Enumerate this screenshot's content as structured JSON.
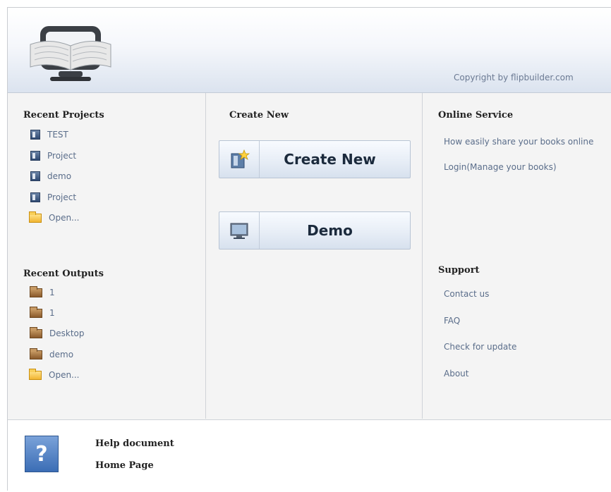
{
  "header": {
    "copyright": "Copyright by flipbuilder.com",
    "logo_icon": "monitor-book-logo-icon"
  },
  "recent_projects": {
    "title": "Recent Projects",
    "items": [
      {
        "label": "TEST",
        "icon": "document-icon"
      },
      {
        "label": "Project",
        "icon": "document-icon"
      },
      {
        "label": "demo",
        "icon": "document-icon"
      },
      {
        "label": "Project",
        "icon": "document-icon"
      },
      {
        "label": "Open...",
        "icon": "folder-open-icon"
      }
    ]
  },
  "recent_outputs": {
    "title": "Recent Outputs",
    "items": [
      {
        "label": "1",
        "icon": "box-icon"
      },
      {
        "label": "1",
        "icon": "box-icon"
      },
      {
        "label": "Desktop",
        "icon": "box-icon"
      },
      {
        "label": "demo",
        "icon": "box-icon"
      },
      {
        "label": "Open...",
        "icon": "folder-open-icon"
      }
    ]
  },
  "create_new": {
    "title": "Create New",
    "create_button": "Create New",
    "demo_button": "Demo"
  },
  "online_service": {
    "title": "Online Service",
    "links": [
      "How easily share your books online",
      "Login(Manage your books)"
    ]
  },
  "support": {
    "title": "Support",
    "links": [
      "Contact us",
      "FAQ",
      "Check for update",
      "About"
    ]
  },
  "footer": {
    "help_document": "Help document",
    "home_page": "Home Page",
    "help_icon_glyph": "?"
  },
  "colors": {
    "link": "#5a6d8a",
    "header_gradient_end": "#dbe3ef",
    "panel_bg": "#f4f4f4"
  }
}
